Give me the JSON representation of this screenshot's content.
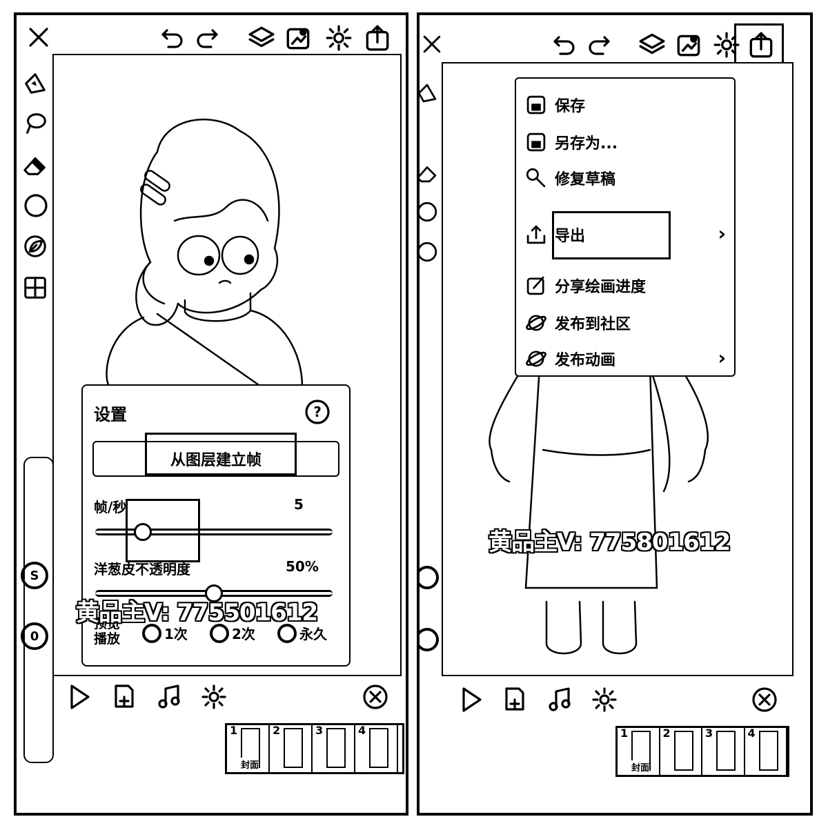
{
  "left": {
    "toolbar_icons": [
      "close-icon",
      "undo-icon",
      "redo-icon",
      "layers-icon",
      "import-image-icon",
      "gear-icon",
      "export-icon"
    ],
    "side_icons": [
      "brush-icon",
      "lasso-icon",
      "eraser-icon",
      "circle-icon",
      "leaf-icon",
      "grid-icon"
    ],
    "side_badges": {
      "s": "S",
      "o": "0"
    },
    "settings": {
      "title": "设置",
      "create_button": "从图层建立帧",
      "fps_label": "帧/秒",
      "fps_value": "5",
      "fps_level": 0.2,
      "onion_label": "洋葱皮不透明度",
      "onion_value": "50%",
      "onion_level": 0.5,
      "preview_label_line1": "预览",
      "preview_label_line2": "播放",
      "play_options": [
        "1次",
        "2次",
        "永久"
      ]
    },
    "watermark": "黄品主V: 775501612",
    "bottom_icons": [
      "play-icon",
      "add-frame-icon",
      "music-icon",
      "settings-icon",
      "close-circle-icon"
    ]
  },
  "right": {
    "menu": {
      "items": [
        {
          "label": "保存",
          "icon": "save-icon"
        },
        {
          "label": "另存为...",
          "icon": "save-as-icon"
        },
        {
          "label": "修复草稿",
          "icon": "wrench-icon"
        },
        {
          "label": "导出",
          "icon": "export-icon",
          "has_submenu": true
        },
        {
          "label": "分享绘画进度",
          "icon": "share-edit-icon"
        },
        {
          "label": "发布到社区",
          "icon": "planet-icon"
        },
        {
          "label": "发布动画",
          "icon": "planet-icon",
          "has_submenu": true
        }
      ]
    },
    "watermark": "黄品主V: 775801612"
  },
  "frames": {
    "numbers": [
      "1",
      "2",
      "3",
      "4"
    ],
    "cover_label": "封面"
  }
}
